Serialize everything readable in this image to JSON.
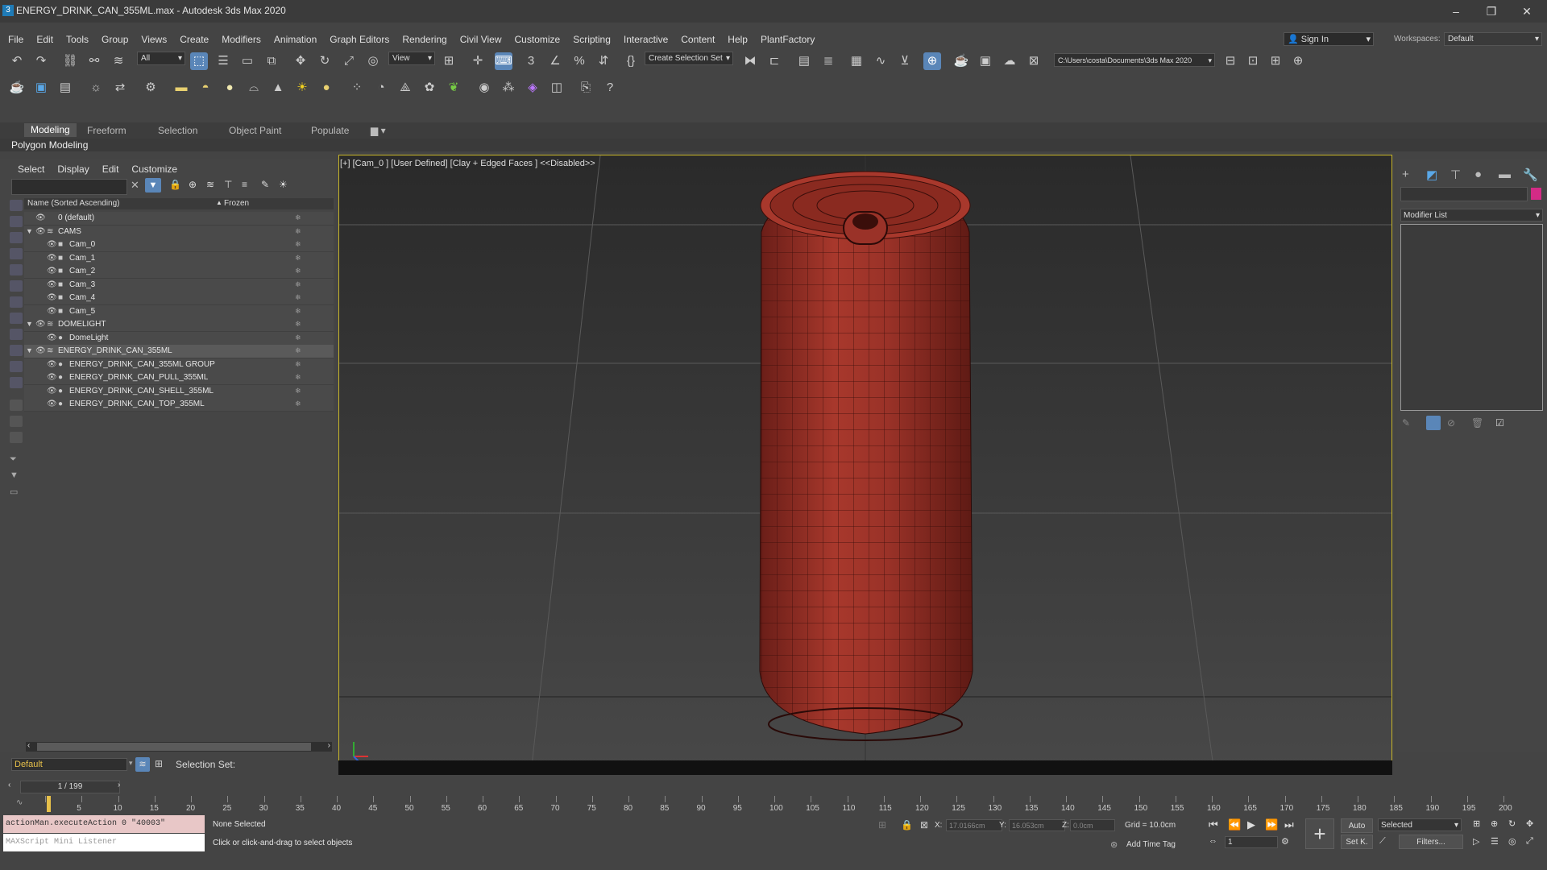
{
  "window": {
    "title": "ENERGY_DRINK_CAN_355ML.max - Autodesk 3ds Max 2020",
    "app_icon": "3",
    "min": "–",
    "max": "❐",
    "close": "✕"
  },
  "menu": [
    "File",
    "Edit",
    "Tools",
    "Group",
    "Views",
    "Create",
    "Modifiers",
    "Animation",
    "Graph Editors",
    "Rendering",
    "Civil View",
    "Customize",
    "Scripting",
    "Interactive",
    "Content",
    "Help",
    "PlantFactory"
  ],
  "signin": "Sign In",
  "workspaces": {
    "label": "Workspaces:",
    "value": "Default"
  },
  "toolbar": {
    "filter": "All",
    "refcoord": "View",
    "selection_set": "Create Selection Set",
    "path": "C:\\Users\\costa\\Documents\\3ds Max 2020"
  },
  "ribbon": {
    "tabs": [
      "Modeling",
      "Freeform",
      "Selection",
      "Object Paint",
      "Populate"
    ],
    "sub": "Polygon Modeling"
  },
  "scene_explorer": {
    "menu": [
      "Select",
      "Display",
      "Edit",
      "Customize"
    ],
    "col_name": "Name (Sorted Ascending)",
    "col_frozen": "Frozen",
    "rows": [
      {
        "label": "0 (default)",
        "indent": 0,
        "arrow": ""
      },
      {
        "label": "CAMS",
        "indent": 0,
        "arrow": "▼"
      },
      {
        "label": "Cam_0",
        "indent": 1,
        "arrow": ""
      },
      {
        "label": "Cam_1",
        "indent": 1,
        "arrow": ""
      },
      {
        "label": "Cam_2",
        "indent": 1,
        "arrow": ""
      },
      {
        "label": "Cam_3",
        "indent": 1,
        "arrow": ""
      },
      {
        "label": "Cam_4",
        "indent": 1,
        "arrow": ""
      },
      {
        "label": "Cam_5",
        "indent": 1,
        "arrow": ""
      },
      {
        "label": "DOMELIGHT",
        "indent": 0,
        "arrow": "▼"
      },
      {
        "label": "DomeLight",
        "indent": 1,
        "arrow": ""
      },
      {
        "label": "ENERGY_DRINK_CAN_355ML",
        "indent": 0,
        "arrow": "▼",
        "selected": true
      },
      {
        "label": "ENERGY_DRINK_CAN_355ML GROUP",
        "indent": 1,
        "arrow": ""
      },
      {
        "label": "ENERGY_DRINK_CAN_PULL_355ML",
        "indent": 1,
        "arrow": ""
      },
      {
        "label": "ENERGY_DRINK_CAN_SHELL_355ML",
        "indent": 1,
        "arrow": ""
      },
      {
        "label": "ENERGY_DRINK_CAN_TOP_355ML",
        "indent": 1,
        "arrow": ""
      }
    ],
    "layer": "Default",
    "selection_set": "Selection Set:"
  },
  "viewport": {
    "label": "[+] [Cam_0 ] [User Defined] [Clay + Edged Faces ] <<Disabled>>",
    "model_color": "#8a2a20",
    "wire_color": "#3a0e0a"
  },
  "command_panel": {
    "modifier_list": "Modifier List",
    "color": "#d32b86"
  },
  "timeline": {
    "frame": "1 / 199",
    "ticks": [
      0,
      5,
      10,
      15,
      20,
      25,
      30,
      35,
      40,
      45,
      50,
      55,
      60,
      65,
      70,
      75,
      80,
      85,
      90,
      95,
      100,
      105,
      110,
      115,
      120,
      125,
      130,
      135,
      140,
      145,
      150,
      155,
      160,
      165,
      170,
      175,
      180,
      185,
      190,
      195,
      200
    ]
  },
  "status": {
    "maxscript": "actionMan.executeAction 0 \"40003\"",
    "listener": "MAXScript Mini Listener",
    "none_selected": "None Selected",
    "hint": "Click or click-and-drag to select objects",
    "x_label": "X:",
    "x_val": "17.0166cm",
    "y_label": "Y:",
    "y_val": "16.053cm",
    "z_label": "Z:",
    "z_val": "0.0cm",
    "grid": "Grid = 10.0cm",
    "add_time_tag": "Add Time Tag",
    "auto": "Auto",
    "selected": "Selected",
    "setk": "Set K.",
    "filters": "Filters...",
    "frame_val": "1"
  }
}
